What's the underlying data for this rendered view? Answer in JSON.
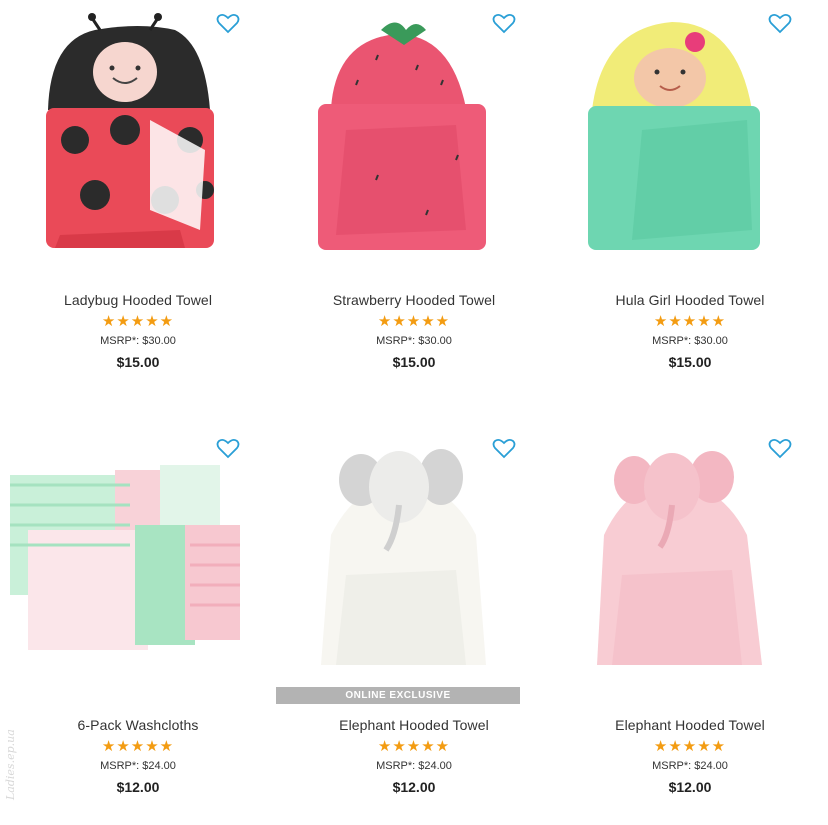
{
  "colors": {
    "heart": "#2a9fd6",
    "stars": "#f39c12",
    "badge_bg": "#b3b3b3"
  },
  "products": [
    {
      "name": "Ladybug Hooded Towel",
      "stars": "★★★★★",
      "msrp": "MSRP*: $30.00",
      "price": "$15.00",
      "image": "ladybug-towel-image",
      "rating": 5
    },
    {
      "name": "Strawberry Hooded Towel",
      "stars": "★★★★★",
      "msrp": "MSRP*: $30.00",
      "price": "$15.00",
      "image": "strawberry-towel-image",
      "rating": 5
    },
    {
      "name": "Hula Girl Hooded Towel",
      "stars": "★★★★★",
      "msrp": "MSRP*: $30.00",
      "price": "$15.00",
      "image": "hula-girl-towel-image",
      "rating": 5
    },
    {
      "name": "6-Pack Washcloths",
      "stars": "★★★★★",
      "msrp": "MSRP*: $24.00",
      "price": "$12.00",
      "image": "washcloths-image",
      "rating": 5
    },
    {
      "name": "Elephant Hooded Towel",
      "stars": "★★★★★",
      "msrp": "MSRP*: $24.00",
      "price": "$12.00",
      "image": "white-elephant-towel-image",
      "rating": 4.5
    },
    {
      "name": "Elephant Hooded Towel",
      "stars": "★★★★★",
      "msrp": "MSRP*: $24.00",
      "price": "$12.00",
      "image": "pink-elephant-towel-image",
      "rating": 4.5
    }
  ],
  "badge": "ONLINE EXCLUSIVE",
  "watermark": "Ladies.ep.ua"
}
